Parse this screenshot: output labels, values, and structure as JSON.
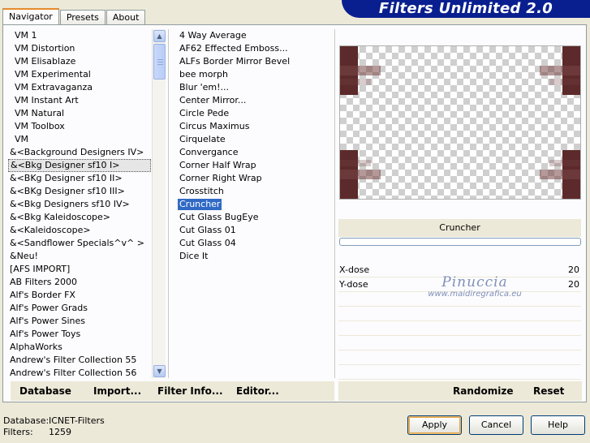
{
  "window_title": "Filters Unlimited 2.0",
  "tabs": [
    {
      "label": "Navigator",
      "active": true
    },
    {
      "label": "Presets",
      "active": false
    },
    {
      "label": "About",
      "active": false
    }
  ],
  "categories": [
    "VM 1",
    "VM Distortion",
    "VM Elisablaze",
    "VM Experimental",
    "VM Extravaganza",
    "VM Instant Art",
    "VM Natural",
    "VM Toolbox",
    "VM",
    "&<Background Designers IV>",
    "&<Bkg Designer sf10 I>",
    "&<BKg Designer sf10 II>",
    "&<BKg Designer sf10 III>",
    "&<Bkg Designers sf10 IV>",
    "&<Bkg Kaleidoscope>",
    "&<Kaleidoscope>",
    "&<Sandflower Specials^v^ >",
    "&Neu!",
    "[AFS IMPORT]",
    "AB Filters 2000",
    "Alf's Border FX",
    "Alf's Power Grads",
    "Alf's Power Sines",
    "Alf's Power Toys",
    "AlphaWorks",
    "Andrew's Filter Collection 55",
    "Andrew's Filter Collection 56"
  ],
  "selected_category_index": 10,
  "filters": [
    "4 Way Average",
    "AF62 Effected Emboss...",
    "ALFs Border Mirror Bevel",
    "bee morph",
    "Blur 'em!...",
    "Center Mirror...",
    "Circle Pede",
    "Circus Maximus",
    "Cirquelate",
    "Convergance",
    "Corner Half Wrap",
    "Corner Right Wrap",
    "Crosstitch",
    "Cruncher",
    "Cut Glass  BugEye",
    "Cut Glass 01",
    "Cut Glass 04",
    "Dice It"
  ],
  "selected_filter_index": 13,
  "preview": {
    "current_filter": "Cruncher",
    "progress": 0
  },
  "params": [
    {
      "label": "X-dose",
      "value": "20"
    },
    {
      "label": "Y-dose",
      "value": "20"
    },
    {
      "label": "",
      "value": ""
    },
    {
      "label": "",
      "value": ""
    },
    {
      "label": "",
      "value": ""
    },
    {
      "label": "",
      "value": ""
    },
    {
      "label": "",
      "value": ""
    },
    {
      "label": "",
      "value": ""
    }
  ],
  "watermark": {
    "name": "Pinuccia",
    "site": "www.maidiregrafica.eu"
  },
  "bottom_buttons": {
    "database": "Database",
    "import": "Import...",
    "filter_info": "Filter Info...",
    "editor": "Editor...",
    "randomize": "Randomize",
    "reset": "Reset"
  },
  "status": {
    "database_label": "Database:",
    "database_value": "ICNET-Filters",
    "filters_label": "Filters:",
    "filters_value": "1259"
  },
  "dialog_buttons": {
    "apply": "Apply",
    "cancel": "Cancel",
    "help": "Help"
  },
  "colors": {
    "selection": "#316ac5",
    "title_banner": "#0a1f8f",
    "preview_accent": "#5c2a2a"
  }
}
